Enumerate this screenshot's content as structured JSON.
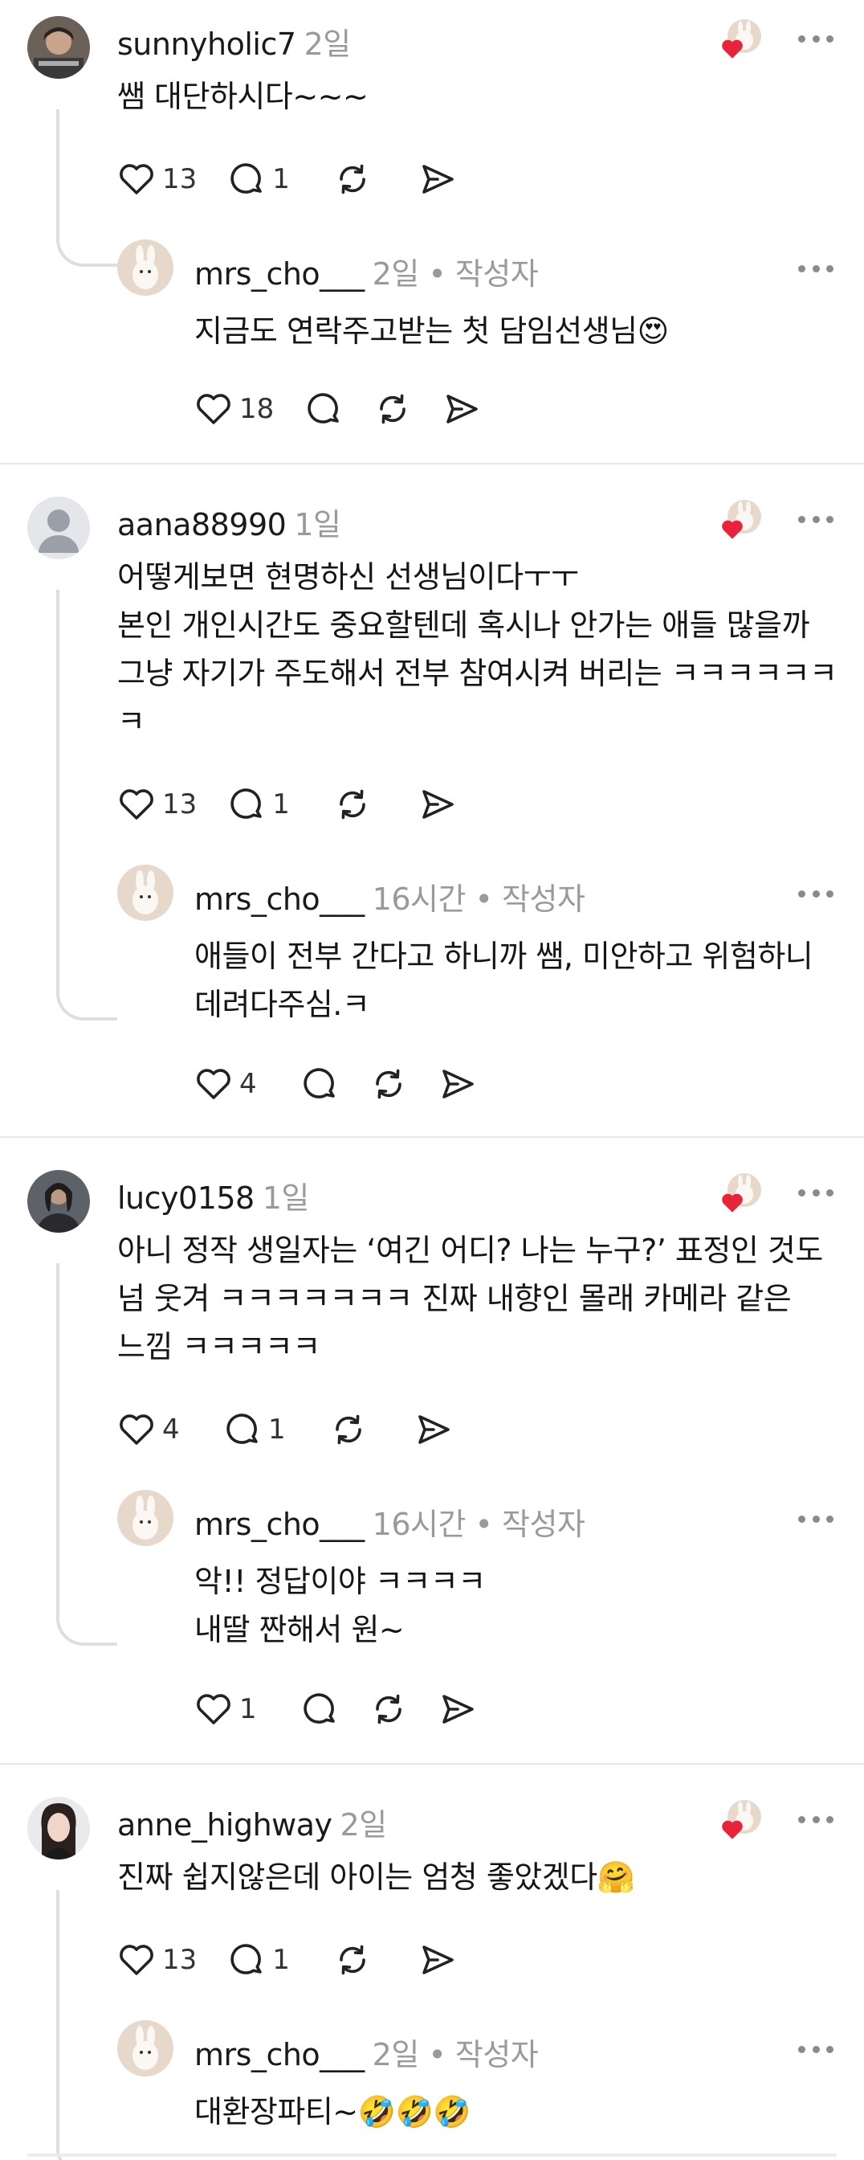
{
  "threads": [
    {
      "comment": {
        "username": "sunnyholic7",
        "time": "2일",
        "lines": [
          "쌤 대단하시다~~~"
        ],
        "likes": "13",
        "replies": "1"
      },
      "reply": {
        "username": "mrs_cho___",
        "meta": "2일 • 작성자",
        "lines": [
          "지금도 연락주고받는 첫 담임선생님😍"
        ],
        "likes": "18",
        "replies": ""
      }
    },
    {
      "comment": {
        "username": "aana88990",
        "time": "1일",
        "lines": [
          "어떻게보면 현명하신 선생님이다ㅜㅜ",
          "본인 개인시간도 중요할텐데 혹시나 안가는 애들 많을까",
          "그냥 자기가 주도해서 전부 참여시켜 버리는 ㅋㅋㅋㅋㅋㅋ",
          "ㅋ"
        ],
        "likes": "13",
        "replies": "1"
      },
      "reply": {
        "username": "mrs_cho___",
        "meta": "16시간 • 작성자",
        "lines": [
          "애들이 전부 간다고 하니까 쌤, 미안하고 위험하니",
          "데려다주심.ㅋ"
        ],
        "likes": "4",
        "replies": ""
      }
    },
    {
      "comment": {
        "username": "lucy0158",
        "time": "1일",
        "lines": [
          "아니 정작 생일자는 ‘여긴 어디? 나는 누구?’ 표정인 것도",
          "넘 웃겨 ㅋㅋㅋㅋㅋㅋㅋ 진짜 내향인 몰래 카메라 같은",
          "느낌 ㅋㅋㅋㅋㅋ"
        ],
        "likes": "4",
        "replies": "1"
      },
      "reply": {
        "username": "mrs_cho___",
        "meta": "16시간 • 작성자",
        "lines": [
          "악!! 정답이야 ㅋㅋㅋㅋ",
          "내딸 짠해서 원~"
        ],
        "likes": "1",
        "replies": ""
      }
    },
    {
      "comment": {
        "username": "anne_highway",
        "time": "2일",
        "lines": [
          "진짜 쉽지않은데 아이는 엄청 좋았겠다🤗"
        ],
        "likes": "13",
        "replies": "1"
      },
      "reply": {
        "username": "mrs_cho___",
        "meta": "2일 • 작성자",
        "lines": [
          "대환장파티~🤣🤣🤣"
        ],
        "likes": "",
        "replies": ""
      }
    }
  ],
  "icons": {
    "like": "heart-outline-icon",
    "reply": "speech-bubble-icon",
    "repost": "repost-icon",
    "share": "send-icon",
    "more": "more-dots-icon",
    "liked_by_author": "author-liked-badge"
  },
  "colors": {
    "text": "#151515",
    "muted": "#9a9a9a",
    "icon": "#222222",
    "heart": "#e8233a",
    "divider": "#e8e8e8"
  }
}
